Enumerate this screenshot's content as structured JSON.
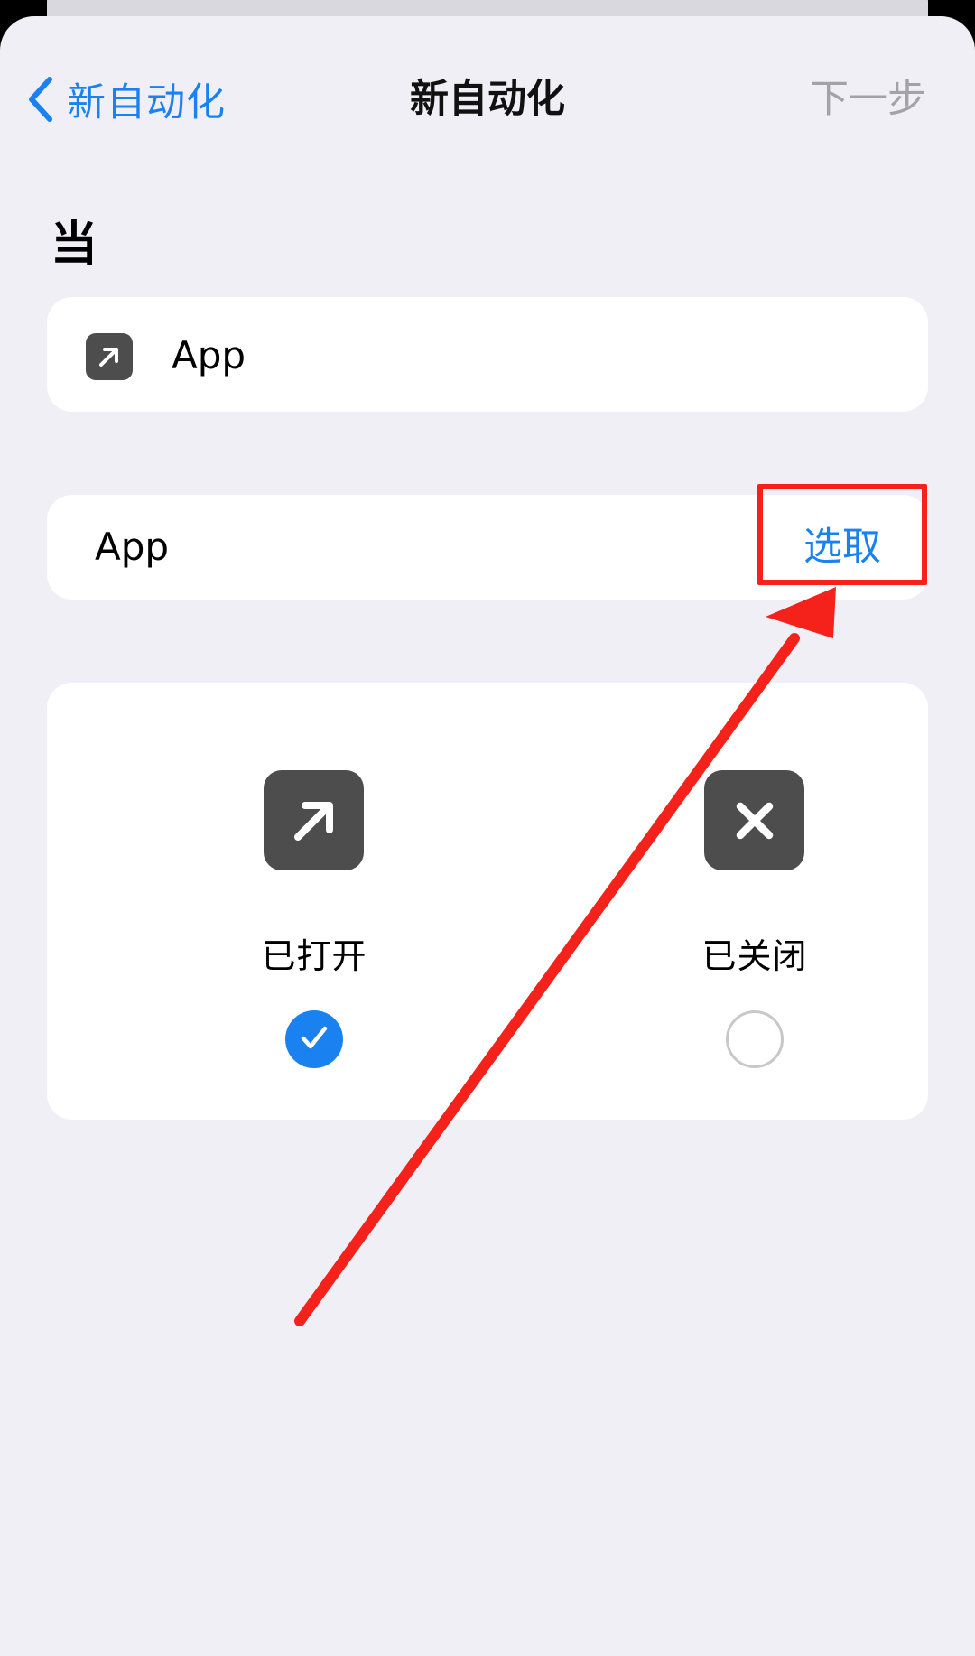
{
  "nav": {
    "back_label": "新自动化",
    "title": "新自动化",
    "next_label": "下一步"
  },
  "section": {
    "header": "当"
  },
  "trigger": {
    "icon": "arrow-up-right-icon",
    "label": "App"
  },
  "app_row": {
    "label": "App",
    "choose_label": "选取"
  },
  "states": [
    {
      "label": "已打开",
      "icon": "arrow-up-right-icon",
      "selected": true
    },
    {
      "label": "已关闭",
      "icon": "close-x-icon",
      "selected": false
    }
  ],
  "colors": {
    "accent": "#1a82f0",
    "annotation": "#f5221b",
    "background": "#f1eff6",
    "icon_bg": "#4d4d4d"
  }
}
